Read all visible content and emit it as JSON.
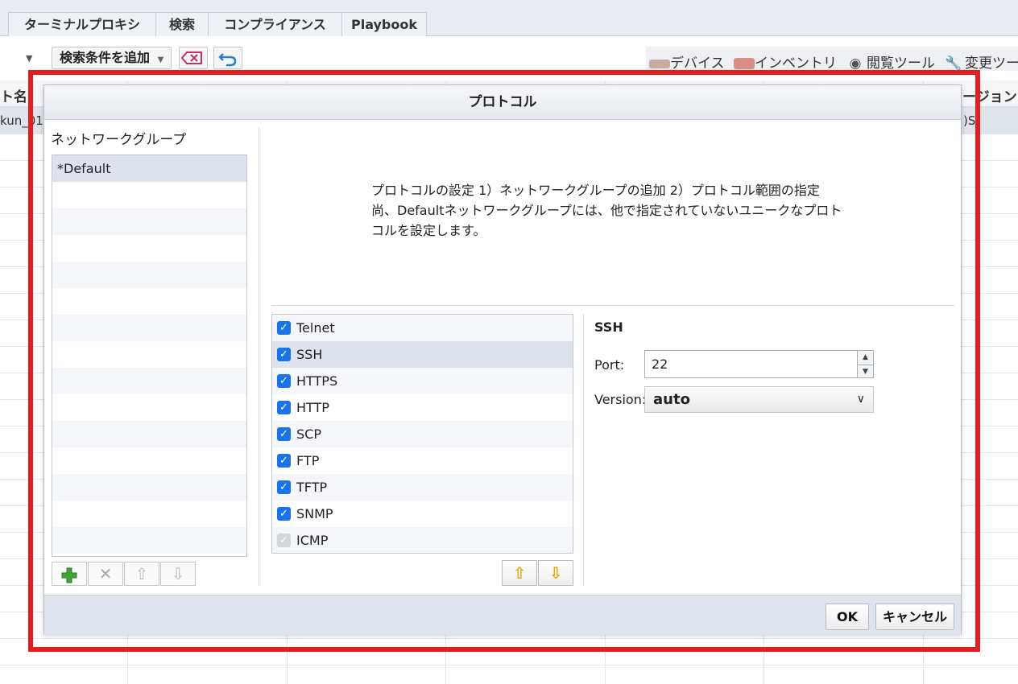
{
  "app": {
    "tabs": [
      {
        "label": "ターミナルプロキシ"
      },
      {
        "label": "検索"
      },
      {
        "label": "コンプライアンス"
      },
      {
        "label": "Playbook"
      }
    ],
    "toolbar": {
      "add_filter_label": "検索条件を追加",
      "links": [
        {
          "label": "デバイス",
          "icon": "device-icon"
        },
        {
          "label": "インベントリ",
          "icon": "inventory-icon"
        },
        {
          "label": "閲覧ツール",
          "icon": "eye-icon"
        },
        {
          "label": "変更ツー",
          "icon": "wrench-icon"
        }
      ]
    },
    "grid": {
      "header_left": "ト名",
      "header_right": "ージョン",
      "row1_left": "kun_01",
      "row1_right": ")S"
    }
  },
  "dialog": {
    "title": "プロトコル",
    "network_group_label": "ネットワークグループ",
    "network_groups": [
      {
        "label": "*Default",
        "selected": true
      }
    ],
    "description_lines": [
      "プロトコルの設定 1）ネットワークグループの追加 2）プロトコル範囲の指定",
      "尚、Defaultネットワークグループには、他で指定されていないユニークなプロト",
      "コルを設定します。"
    ],
    "protocols": [
      {
        "label": "Telnet",
        "checked": true,
        "enabled": true
      },
      {
        "label": "SSH",
        "checked": true,
        "enabled": true,
        "selected": true
      },
      {
        "label": "HTTPS",
        "checked": true,
        "enabled": true
      },
      {
        "label": "HTTP",
        "checked": true,
        "enabled": true
      },
      {
        "label": "SCP",
        "checked": true,
        "enabled": true
      },
      {
        "label": "FTP",
        "checked": true,
        "enabled": true
      },
      {
        "label": "TFTP",
        "checked": true,
        "enabled": true
      },
      {
        "label": "SNMP",
        "checked": true,
        "enabled": true
      },
      {
        "label": "ICMP",
        "checked": true,
        "enabled": false
      }
    ],
    "detail": {
      "title": "SSH",
      "port_label": "Port:",
      "port_value": "22",
      "version_label": "Version:",
      "version_value": "auto"
    },
    "buttons": {
      "ok": "OK",
      "cancel": "キャンセル"
    }
  },
  "colors": {
    "highlight": "#e31e1e",
    "checkbox": "#1a73e8",
    "arrow": "#e4a800",
    "add": "#3fa535"
  }
}
